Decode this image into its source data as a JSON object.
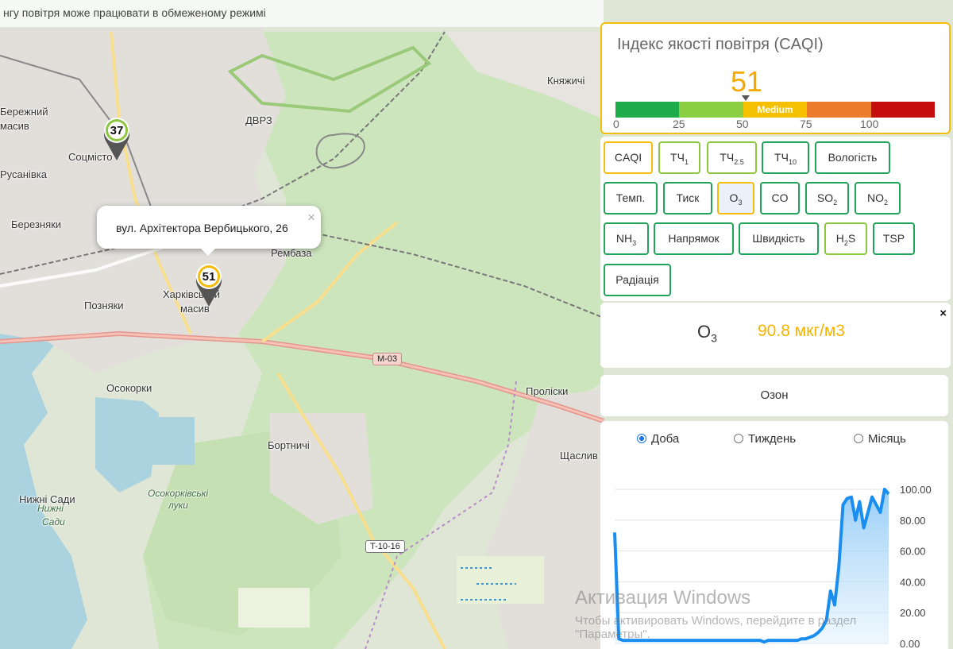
{
  "banner": "нгу повітря може працювати в обмеженому режимі",
  "map": {
    "places": [
      "Бережний",
      "масив",
      "Русанівка",
      "Соцмісто",
      "ДВРЗ",
      "Березняки",
      "Позняки",
      "Харківський",
      "масив",
      "Рембаза",
      "Осокорки",
      "Бортничі",
      "Нижні Сади",
      "Нижні",
      "Сади",
      "Осокорківські",
      "луки",
      "Княжичі",
      "Проліски",
      "Щаслив"
    ],
    "roads": [
      "M-03",
      "T-10-16"
    ],
    "markers": [
      {
        "value": "37",
        "color": "#8dc63f"
      },
      {
        "value": "51",
        "color": "#f5bd0b"
      }
    ],
    "popup": {
      "address": "вул. Архітектора Вербицького, 26",
      "close": "×"
    }
  },
  "caqi": {
    "title": "Індекс якості повітря (CAQI)",
    "value": "51",
    "segments": [
      {
        "color": "#1fad4b",
        "label": ""
      },
      {
        "color": "#8dcf43",
        "label": ""
      },
      {
        "color": "#f5c000",
        "label": "Medium"
      },
      {
        "color": "#ec7b2c",
        "label": ""
      },
      {
        "color": "#c60d0d",
        "label": ""
      }
    ],
    "ticks": [
      "0",
      "25",
      "50",
      "75",
      "100"
    ]
  },
  "params": [
    {
      "label": "CAQI",
      "sub": "",
      "style": "yellow"
    },
    {
      "label": "ТЧ",
      "sub": "1",
      "style": "lime"
    },
    {
      "label": "ТЧ",
      "sub": "2.5",
      "style": "lime"
    },
    {
      "label": "ТЧ",
      "sub": "10",
      "style": "green"
    },
    {
      "label": "Вологість",
      "sub": "",
      "style": "green"
    },
    {
      "label": "Темп.",
      "sub": "",
      "style": "green"
    },
    {
      "label": "Тиск",
      "sub": "",
      "style": "green"
    },
    {
      "label": "O",
      "sub": "3",
      "style": "yellow active"
    },
    {
      "label": "CO",
      "sub": "",
      "style": "green"
    },
    {
      "label": "SO",
      "sub": "2",
      "style": "green"
    },
    {
      "label": "NO",
      "sub": "2",
      "style": "green"
    },
    {
      "label": "NH",
      "sub": "3",
      "style": "green"
    },
    {
      "label": "Напрямок",
      "sub": "",
      "style": "green"
    },
    {
      "label": "Швидкість",
      "sub": "",
      "style": "green"
    },
    {
      "label": "H",
      "sub": "2",
      "tail": "S",
      "style": "lime"
    },
    {
      "label": "TSP",
      "sub": "",
      "style": "green"
    },
    {
      "label": "Радіація",
      "sub": "",
      "style": "green"
    }
  ],
  "readout": {
    "name": "O",
    "sub": "3",
    "value": "90.8 мкг/м3",
    "close": "×"
  },
  "pollutant_name": "Озон",
  "periods": [
    {
      "label": "Доба",
      "selected": true
    },
    {
      "label": "Тиждень",
      "selected": false
    },
    {
      "label": "Місяць",
      "selected": false
    }
  ],
  "chart_data": {
    "type": "area",
    "title": "",
    "xlabel": "",
    "ylabel": "",
    "ylim": [
      0,
      100
    ],
    "yticks": [
      "100.00",
      "80.00",
      "60.00",
      "40.00",
      "20.00",
      "0.00"
    ],
    "grid": true,
    "color": "#1a8ef0",
    "series": [
      {
        "values": [
          72,
          3,
          2,
          2,
          2,
          2,
          2,
          2,
          2,
          2,
          2,
          2,
          2,
          2,
          2,
          2,
          2,
          2,
          2,
          2,
          2,
          2,
          2,
          2,
          2,
          2,
          2,
          2,
          2,
          2,
          2,
          2,
          2,
          2,
          2,
          2,
          1,
          2,
          2,
          2,
          2,
          2,
          2,
          2,
          2,
          3,
          3,
          4,
          5,
          7,
          10,
          15,
          34,
          25,
          50,
          90,
          94,
          95,
          80,
          92,
          75,
          85,
          95,
          90,
          85,
          100,
          97
        ]
      }
    ]
  },
  "watermark": {
    "line1": "Активация Windows",
    "line2": "Чтобы активировать Windows, перейдите в раздел",
    "line3": "\"Параметры\"."
  }
}
